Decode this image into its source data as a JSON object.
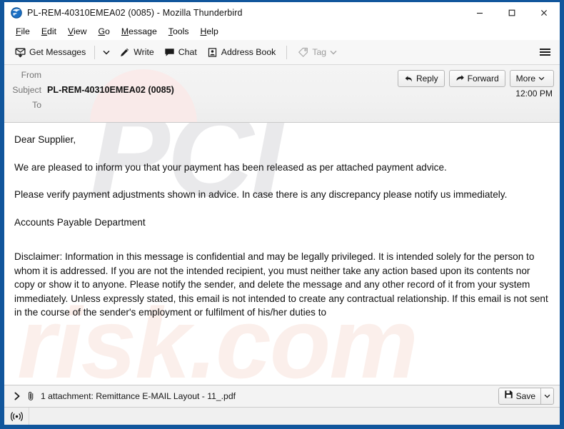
{
  "window": {
    "title": "PL-REM-40310EMEA02 (0085) - Mozilla Thunderbird",
    "app_icon": "thunderbird-icon",
    "accent_border": "#11569c",
    "controls": {
      "minimize": "minimize-icon",
      "maximize": "maximize-icon",
      "close": "close-icon"
    }
  },
  "menubar": {
    "items": [
      {
        "label": "File",
        "access_key": "F"
      },
      {
        "label": "Edit",
        "access_key": "E"
      },
      {
        "label": "View",
        "access_key": "V"
      },
      {
        "label": "Go",
        "access_key": "G"
      },
      {
        "label": "Message",
        "access_key": "M"
      },
      {
        "label": "Tools",
        "access_key": "T"
      },
      {
        "label": "Help",
        "access_key": "H"
      }
    ]
  },
  "toolbar": {
    "get_messages": "Get Messages",
    "write": "Write",
    "chat": "Chat",
    "address_book": "Address Book",
    "tag": "Tag",
    "tag_disabled": true,
    "app_menu": "app-menu-button"
  },
  "message_header": {
    "fields": [
      {
        "label": "From",
        "value": ""
      },
      {
        "label": "Subject",
        "value": "PL-REM-40310EMEA02 (0085)",
        "bold": true
      },
      {
        "label": "To",
        "value": ""
      }
    ],
    "date": "12:00 PM",
    "actions": {
      "reply": "Reply",
      "forward": "Forward",
      "more": "More"
    }
  },
  "message_body": {
    "paragraphs": [
      "Dear Supplier,",
      "We are pleased to inform you that your payment has been released as per attached payment advice.",
      "Please verify payment adjustments shown in advice. In case there is any discrepancy please notify us immediately.",
      "Accounts Payable Department"
    ],
    "disclaimer": "Disclaimer: Information in this message is confidential and may be legally privileged. It is intended solely for the person to whom it is addressed. If you are not the intended recipient, you must neither take any action based upon its contents nor copy or show it to anyone. Please notify the sender, and delete the message and any other record of it from your system immediately. Unless expressly stated, this email is not intended to create any contractual relationship. If this email is not sent in the course of the sender's employment or fulfilment of his/her duties to",
    "watermark_top": "PCI",
    "watermark_bottom": "risk.com"
  },
  "attachment_bar": {
    "expand_icon": "chevron-right-icon",
    "clip_icon": "paperclip-icon",
    "text": "1 attachment: Remittance E-MAIL Layout - 11_.pdf",
    "save_label": "Save"
  },
  "status_bar": {
    "icon": "broadcast-icon"
  }
}
